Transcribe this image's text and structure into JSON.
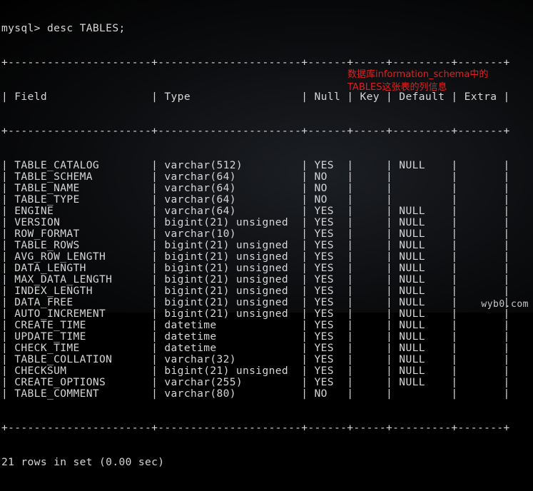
{
  "terminal": {
    "command_line": "mysql> desc TABLES;",
    "border": "+----------------------+----------------------+------+-----+---------+-------+",
    "columns": [
      "Field",
      "Type",
      "Null",
      "Key",
      "Default",
      "Extra"
    ],
    "rows": [
      [
        "TABLE_CATALOG",
        "varchar(512)",
        "YES",
        "",
        "NULL",
        ""
      ],
      [
        "TABLE_SCHEMA",
        "varchar(64)",
        "NO",
        "",
        "",
        ""
      ],
      [
        "TABLE_NAME",
        "varchar(64)",
        "NO",
        "",
        "",
        ""
      ],
      [
        "TABLE_TYPE",
        "varchar(64)",
        "NO",
        "",
        "",
        ""
      ],
      [
        "ENGINE",
        "varchar(64)",
        "YES",
        "",
        "NULL",
        ""
      ],
      [
        "VERSION",
        "bigint(21) unsigned",
        "YES",
        "",
        "NULL",
        ""
      ],
      [
        "ROW_FORMAT",
        "varchar(10)",
        "YES",
        "",
        "NULL",
        ""
      ],
      [
        "TABLE_ROWS",
        "bigint(21) unsigned",
        "YES",
        "",
        "NULL",
        ""
      ],
      [
        "AVG_ROW_LENGTH",
        "bigint(21) unsigned",
        "YES",
        "",
        "NULL",
        ""
      ],
      [
        "DATA_LENGTH",
        "bigint(21) unsigned",
        "YES",
        "",
        "NULL",
        ""
      ],
      [
        "MAX_DATA_LENGTH",
        "bigint(21) unsigned",
        "YES",
        "",
        "NULL",
        ""
      ],
      [
        "INDEX_LENGTH",
        "bigint(21) unsigned",
        "YES",
        "",
        "NULL",
        ""
      ],
      [
        "DATA_FREE",
        "bigint(21) unsigned",
        "YES",
        "",
        "NULL",
        ""
      ],
      [
        "AUTO_INCREMENT",
        "bigint(21) unsigned",
        "YES",
        "",
        "NULL",
        ""
      ],
      [
        "CREATE_TIME",
        "datetime",
        "YES",
        "",
        "NULL",
        ""
      ],
      [
        "UPDATE_TIME",
        "datetime",
        "YES",
        "",
        "NULL",
        ""
      ],
      [
        "CHECK_TIME",
        "datetime",
        "YES",
        "",
        "NULL",
        ""
      ],
      [
        "TABLE_COLLATION",
        "varchar(32)",
        "YES",
        "",
        "NULL",
        ""
      ],
      [
        "CHECKSUM",
        "bigint(21) unsigned",
        "YES",
        "",
        "NULL",
        ""
      ],
      [
        "CREATE_OPTIONS",
        "varchar(255)",
        "YES",
        "",
        "NULL",
        ""
      ],
      [
        "TABLE_COMMENT",
        "varchar(80)",
        "NO",
        "",
        "",
        ""
      ]
    ],
    "result_line": "21 rows in set (0.00 sec)"
  },
  "annotation": {
    "line1": "数据库information_schema中的",
    "line2": "TABLES这张表的列信息"
  },
  "watermark": "wyb0.com",
  "colors": {
    "text": "#d6d6d6",
    "annotation": "#e02020",
    "background": "#000000"
  }
}
